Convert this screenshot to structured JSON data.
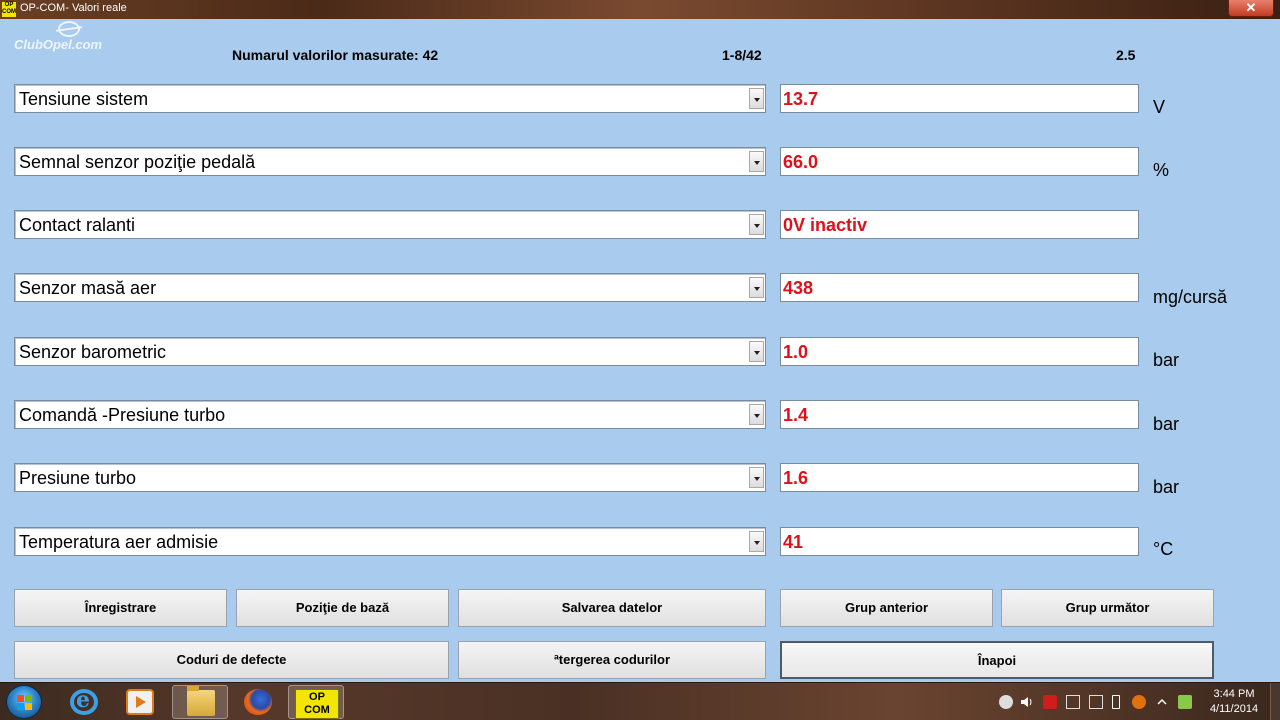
{
  "window": {
    "app_icon_text": "OP\nCOM",
    "title": "OP-COM- Valori reale",
    "close_symbol": "✕"
  },
  "logo": {
    "text": "ClubOpel.com"
  },
  "header": {
    "count_label": "Numarul valorilor masurate: 42",
    "range": "1-8/42",
    "version": "2.5"
  },
  "rows": [
    {
      "label": "Tensiune sistem",
      "value": "13.7",
      "unit": "V"
    },
    {
      "label": "Semnal senzor poziţie pedală",
      "value": "66.0",
      "unit": "%"
    },
    {
      "label": "Contact ralanti",
      "value": "0V inactiv",
      "unit": ""
    },
    {
      "label": "Senzor masă aer",
      "value": "438",
      "unit": "mg/cursă"
    },
    {
      "label": "Senzor barometric",
      "value": "1.0",
      "unit": "bar"
    },
    {
      "label": "Comandă -Presiune turbo",
      "value": "1.4",
      "unit": "bar"
    },
    {
      "label": "Presiune turbo",
      "value": "1.6",
      "unit": "bar"
    },
    {
      "label": "Temperatura aer admisie",
      "value": "41",
      "unit": "°C"
    }
  ],
  "buttons": {
    "record": "Înregistrare",
    "base_position": "Poziţie de bază",
    "save_data": "Salvarea datelor",
    "prev_group": "Grup anterior",
    "next_group": "Grup următor",
    "fault_codes": "Coduri de defecte",
    "clear_codes": "ªtergerea codurilor",
    "back": "Înapoi"
  },
  "taskbar": {
    "opcom_label": "OP\nCOM",
    "time": "3:44 PM",
    "date": "4/11/2014"
  },
  "colors": {
    "background": "#a9cbed",
    "value_text": "#e0101a",
    "opcom_yellow": "#f2e600"
  }
}
